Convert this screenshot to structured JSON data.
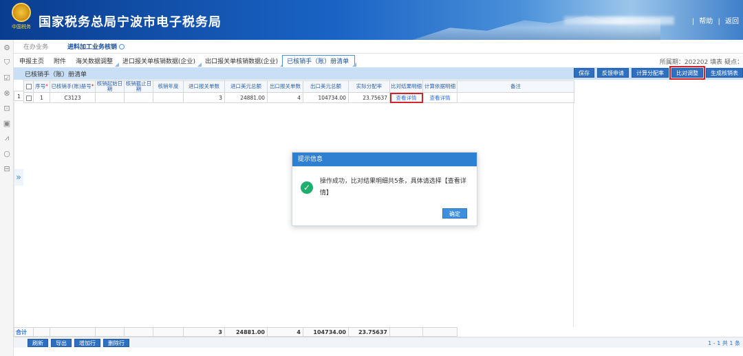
{
  "header": {
    "title": "国家税务总局宁波市电子税务局",
    "emblem_caption": "中国税务",
    "links": [
      "|",
      "帮助",
      "|",
      "返回"
    ]
  },
  "leftrail": {
    "icons": [
      "gear-icon",
      "shield-icon",
      "check-square-icon",
      "search-user-icon",
      "briefcase-icon",
      "calendar-icon",
      "chart-icon",
      "search-icon",
      "inbox-icon"
    ]
  },
  "toptabs": [
    {
      "label": "在办业务",
      "active": false
    },
    {
      "label": "进料加工业务核销",
      "active": true
    }
  ],
  "subtabs": [
    {
      "label": "申报主页",
      "tri": false,
      "active": false
    },
    {
      "label": "附件",
      "tri": false,
      "active": false
    },
    {
      "label": "海关数据调整",
      "tri": true,
      "active": false
    },
    {
      "label": "进口报关单核销数据(企业)",
      "tri": true,
      "active": false
    },
    {
      "label": "出口报关单核销数据(企业)",
      "tri": true,
      "active": false
    },
    {
      "label": "已核销手（账）册清单",
      "tri": true,
      "active": true
    }
  ],
  "period_text": "所属期：202202  填表  疑点：",
  "bar": {
    "title": "已核销手（账）册清单",
    "buttons": [
      {
        "label": "保存",
        "hl": false
      },
      {
        "label": "反馈申请",
        "hl": false
      },
      {
        "label": "计算分配率",
        "hl": false
      },
      {
        "label": "比对调整",
        "hl": true
      },
      {
        "label": "生成核销表",
        "hl": false
      }
    ]
  },
  "grid": {
    "headers": [
      {
        "label": "",
        "req": false
      },
      {
        "label": "序号",
        "req": true
      },
      {
        "label": "已核销手(账)册号",
        "req": true
      },
      {
        "label": "核销起始日期",
        "req": false
      },
      {
        "label": "核销截止日期",
        "req": false
      },
      {
        "label": "核销年度",
        "req": false
      },
      {
        "label": "进口报关单数",
        "req": false
      },
      {
        "label": "进口美元总额",
        "req": false
      },
      {
        "label": "出口报关单数",
        "req": false
      },
      {
        "label": "出口美元总额",
        "req": false
      },
      {
        "label": "实际分配率",
        "req": false
      },
      {
        "label": "比对结果明细",
        "req": false
      },
      {
        "label": "计算依据明细",
        "req": false
      },
      {
        "label": "备注",
        "req": false
      }
    ],
    "row": {
      "rownum": "1",
      "seq": "1",
      "book_no": "C3123",
      "start": "",
      "end": "",
      "year": "",
      "imp_count": "3",
      "imp_total": "24881.00",
      "exp_count": "4",
      "exp_total": "104734.00",
      "rate": "23.75637",
      "detail1": "查看详情",
      "detail2": "查看详情",
      "note": ""
    }
  },
  "totals": {
    "label": "合计",
    "imp_count": "3",
    "imp_total": "24881.00",
    "exp_count": "4",
    "exp_total": "104734.00",
    "rate": "23.75637"
  },
  "bottom": {
    "buttons": [
      "刷新",
      "导出",
      "增加行",
      "删除行"
    ],
    "pager": "1 - 1  共 1 条"
  },
  "modal": {
    "title": "提示信息",
    "message": "操作成功，比对结果明细共5条，具体请选择【查看详情】",
    "ok": "确定"
  }
}
